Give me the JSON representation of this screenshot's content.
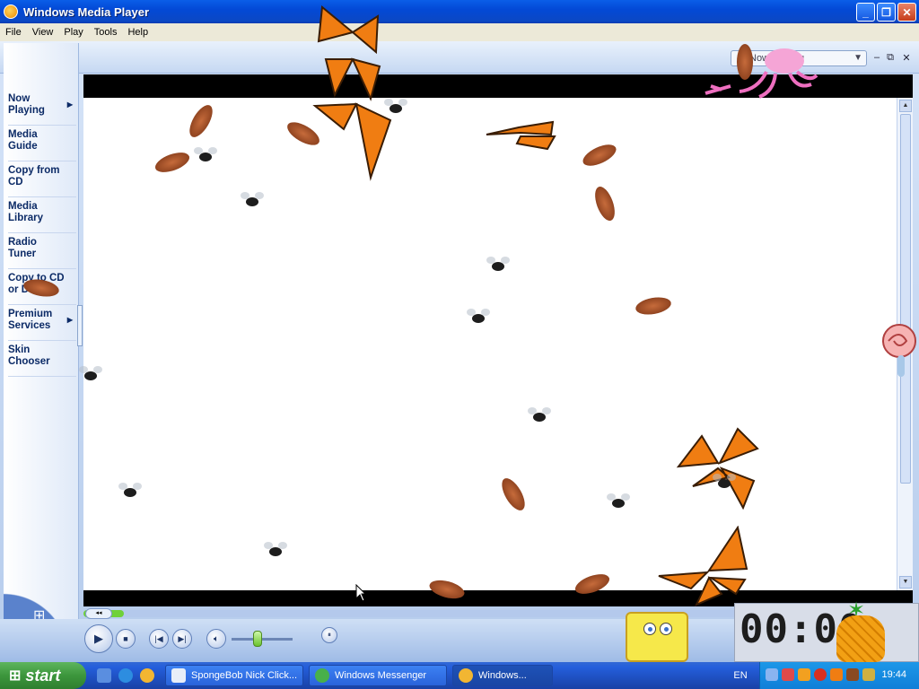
{
  "window": {
    "title": "Windows Media Player",
    "controls": {
      "minimize": "_",
      "maximize": "❐",
      "close": "✕"
    }
  },
  "menu": [
    "File",
    "View",
    "Play",
    "Tools",
    "Help"
  ],
  "topbar": {
    "now_playing_select": "Now Playing",
    "mini_min": "–",
    "mini_max": "⧉",
    "mini_close": "✕"
  },
  "sidebar": {
    "items": [
      {
        "label": "Now\nPlaying",
        "has_chevron": true
      },
      {
        "label": "Media\nGuide"
      },
      {
        "label": "Copy from\nCD"
      },
      {
        "label": "Media\nLibrary"
      },
      {
        "label": "Radio\nTuner"
      },
      {
        "label": "Copy to CD\nor Device"
      },
      {
        "label": "Premium\nServices",
        "has_chevron": true
      },
      {
        "label": "Skin\nChooser"
      }
    ]
  },
  "playback": {
    "seek_progress": 0.05,
    "volume": 0.43,
    "seek_back_label": "◂◂"
  },
  "overlay_clock": "00:00",
  "taskbar": {
    "start_label": "start",
    "tasks": [
      {
        "label": "SpongeBob Nick Click...",
        "icon": "window-icon"
      },
      {
        "label": "Windows Messenger",
        "icon": "messenger-icon"
      },
      {
        "label": "Windows...",
        "icon": "media-player-icon",
        "active": true
      }
    ],
    "language": "EN",
    "time": "19:44"
  },
  "colors": {
    "accent": "#0a5ee8",
    "start_green": "#3c963c",
    "tray_blue": "#0f7fd8",
    "seek_green": "#6fd13a"
  }
}
